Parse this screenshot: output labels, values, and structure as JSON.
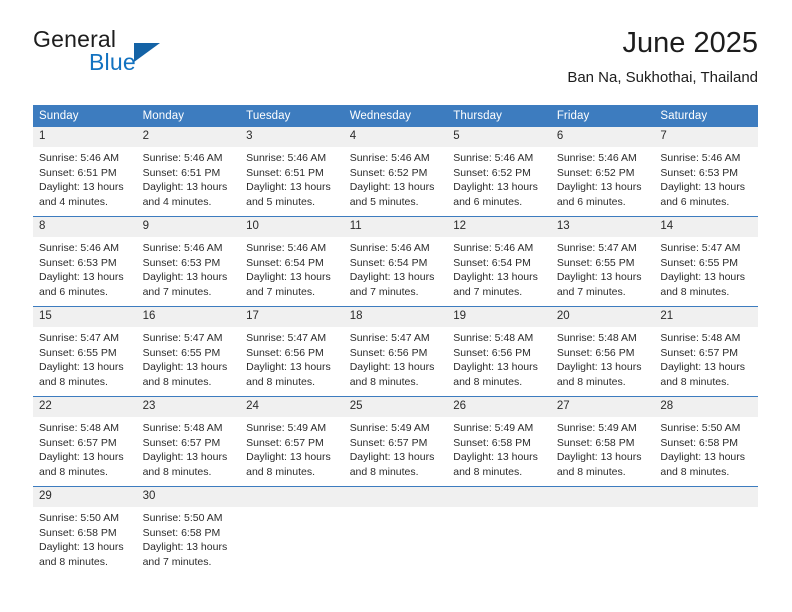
{
  "brand": {
    "word_one": "General",
    "word_two": "Blue",
    "logo_icon": "triangle-logo-icon"
  },
  "header": {
    "title": "June 2025",
    "subtitle": "Ban Na, Sukhothai, Thailand"
  },
  "colors": {
    "header_blue": "#3d7cbf",
    "daynum_band": "#f0f0f0",
    "brand_blue": "#1272c0",
    "text": "#2b2b2b"
  },
  "weekdays": [
    "Sunday",
    "Monday",
    "Tuesday",
    "Wednesday",
    "Thursday",
    "Friday",
    "Saturday"
  ],
  "weeks": [
    [
      {
        "day": "1",
        "sunrise": "Sunrise: 5:46 AM",
        "sunset": "Sunset: 6:51 PM",
        "daylight1": "Daylight: 13 hours",
        "daylight2": "and 4 minutes."
      },
      {
        "day": "2",
        "sunrise": "Sunrise: 5:46 AM",
        "sunset": "Sunset: 6:51 PM",
        "daylight1": "Daylight: 13 hours",
        "daylight2": "and 4 minutes."
      },
      {
        "day": "3",
        "sunrise": "Sunrise: 5:46 AM",
        "sunset": "Sunset: 6:51 PM",
        "daylight1": "Daylight: 13 hours",
        "daylight2": "and 5 minutes."
      },
      {
        "day": "4",
        "sunrise": "Sunrise: 5:46 AM",
        "sunset": "Sunset: 6:52 PM",
        "daylight1": "Daylight: 13 hours",
        "daylight2": "and 5 minutes."
      },
      {
        "day": "5",
        "sunrise": "Sunrise: 5:46 AM",
        "sunset": "Sunset: 6:52 PM",
        "daylight1": "Daylight: 13 hours",
        "daylight2": "and 6 minutes."
      },
      {
        "day": "6",
        "sunrise": "Sunrise: 5:46 AM",
        "sunset": "Sunset: 6:52 PM",
        "daylight1": "Daylight: 13 hours",
        "daylight2": "and 6 minutes."
      },
      {
        "day": "7",
        "sunrise": "Sunrise: 5:46 AM",
        "sunset": "Sunset: 6:53 PM",
        "daylight1": "Daylight: 13 hours",
        "daylight2": "and 6 minutes."
      }
    ],
    [
      {
        "day": "8",
        "sunrise": "Sunrise: 5:46 AM",
        "sunset": "Sunset: 6:53 PM",
        "daylight1": "Daylight: 13 hours",
        "daylight2": "and 6 minutes."
      },
      {
        "day": "9",
        "sunrise": "Sunrise: 5:46 AM",
        "sunset": "Sunset: 6:53 PM",
        "daylight1": "Daylight: 13 hours",
        "daylight2": "and 7 minutes."
      },
      {
        "day": "10",
        "sunrise": "Sunrise: 5:46 AM",
        "sunset": "Sunset: 6:54 PM",
        "daylight1": "Daylight: 13 hours",
        "daylight2": "and 7 minutes."
      },
      {
        "day": "11",
        "sunrise": "Sunrise: 5:46 AM",
        "sunset": "Sunset: 6:54 PM",
        "daylight1": "Daylight: 13 hours",
        "daylight2": "and 7 minutes."
      },
      {
        "day": "12",
        "sunrise": "Sunrise: 5:46 AM",
        "sunset": "Sunset: 6:54 PM",
        "daylight1": "Daylight: 13 hours",
        "daylight2": "and 7 minutes."
      },
      {
        "day": "13",
        "sunrise": "Sunrise: 5:47 AM",
        "sunset": "Sunset: 6:55 PM",
        "daylight1": "Daylight: 13 hours",
        "daylight2": "and 7 minutes."
      },
      {
        "day": "14",
        "sunrise": "Sunrise: 5:47 AM",
        "sunset": "Sunset: 6:55 PM",
        "daylight1": "Daylight: 13 hours",
        "daylight2": "and 8 minutes."
      }
    ],
    [
      {
        "day": "15",
        "sunrise": "Sunrise: 5:47 AM",
        "sunset": "Sunset: 6:55 PM",
        "daylight1": "Daylight: 13 hours",
        "daylight2": "and 8 minutes."
      },
      {
        "day": "16",
        "sunrise": "Sunrise: 5:47 AM",
        "sunset": "Sunset: 6:55 PM",
        "daylight1": "Daylight: 13 hours",
        "daylight2": "and 8 minutes."
      },
      {
        "day": "17",
        "sunrise": "Sunrise: 5:47 AM",
        "sunset": "Sunset: 6:56 PM",
        "daylight1": "Daylight: 13 hours",
        "daylight2": "and 8 minutes."
      },
      {
        "day": "18",
        "sunrise": "Sunrise: 5:47 AM",
        "sunset": "Sunset: 6:56 PM",
        "daylight1": "Daylight: 13 hours",
        "daylight2": "and 8 minutes."
      },
      {
        "day": "19",
        "sunrise": "Sunrise: 5:48 AM",
        "sunset": "Sunset: 6:56 PM",
        "daylight1": "Daylight: 13 hours",
        "daylight2": "and 8 minutes."
      },
      {
        "day": "20",
        "sunrise": "Sunrise: 5:48 AM",
        "sunset": "Sunset: 6:56 PM",
        "daylight1": "Daylight: 13 hours",
        "daylight2": "and 8 minutes."
      },
      {
        "day": "21",
        "sunrise": "Sunrise: 5:48 AM",
        "sunset": "Sunset: 6:57 PM",
        "daylight1": "Daylight: 13 hours",
        "daylight2": "and 8 minutes."
      }
    ],
    [
      {
        "day": "22",
        "sunrise": "Sunrise: 5:48 AM",
        "sunset": "Sunset: 6:57 PM",
        "daylight1": "Daylight: 13 hours",
        "daylight2": "and 8 minutes."
      },
      {
        "day": "23",
        "sunrise": "Sunrise: 5:48 AM",
        "sunset": "Sunset: 6:57 PM",
        "daylight1": "Daylight: 13 hours",
        "daylight2": "and 8 minutes."
      },
      {
        "day": "24",
        "sunrise": "Sunrise: 5:49 AM",
        "sunset": "Sunset: 6:57 PM",
        "daylight1": "Daylight: 13 hours",
        "daylight2": "and 8 minutes."
      },
      {
        "day": "25",
        "sunrise": "Sunrise: 5:49 AM",
        "sunset": "Sunset: 6:57 PM",
        "daylight1": "Daylight: 13 hours",
        "daylight2": "and 8 minutes."
      },
      {
        "day": "26",
        "sunrise": "Sunrise: 5:49 AM",
        "sunset": "Sunset: 6:58 PM",
        "daylight1": "Daylight: 13 hours",
        "daylight2": "and 8 minutes."
      },
      {
        "day": "27",
        "sunrise": "Sunrise: 5:49 AM",
        "sunset": "Sunset: 6:58 PM",
        "daylight1": "Daylight: 13 hours",
        "daylight2": "and 8 minutes."
      },
      {
        "day": "28",
        "sunrise": "Sunrise: 5:50 AM",
        "sunset": "Sunset: 6:58 PM",
        "daylight1": "Daylight: 13 hours",
        "daylight2": "and 8 minutes."
      }
    ],
    [
      {
        "day": "29",
        "sunrise": "Sunrise: 5:50 AM",
        "sunset": "Sunset: 6:58 PM",
        "daylight1": "Daylight: 13 hours",
        "daylight2": "and 8 minutes."
      },
      {
        "day": "30",
        "sunrise": "Sunrise: 5:50 AM",
        "sunset": "Sunset: 6:58 PM",
        "daylight1": "Daylight: 13 hours",
        "daylight2": "and 7 minutes."
      },
      {
        "day": "",
        "sunrise": "",
        "sunset": "",
        "daylight1": "",
        "daylight2": ""
      },
      {
        "day": "",
        "sunrise": "",
        "sunset": "",
        "daylight1": "",
        "daylight2": ""
      },
      {
        "day": "",
        "sunrise": "",
        "sunset": "",
        "daylight1": "",
        "daylight2": ""
      },
      {
        "day": "",
        "sunrise": "",
        "sunset": "",
        "daylight1": "",
        "daylight2": ""
      },
      {
        "day": "",
        "sunrise": "",
        "sunset": "",
        "daylight1": "",
        "daylight2": ""
      }
    ]
  ]
}
